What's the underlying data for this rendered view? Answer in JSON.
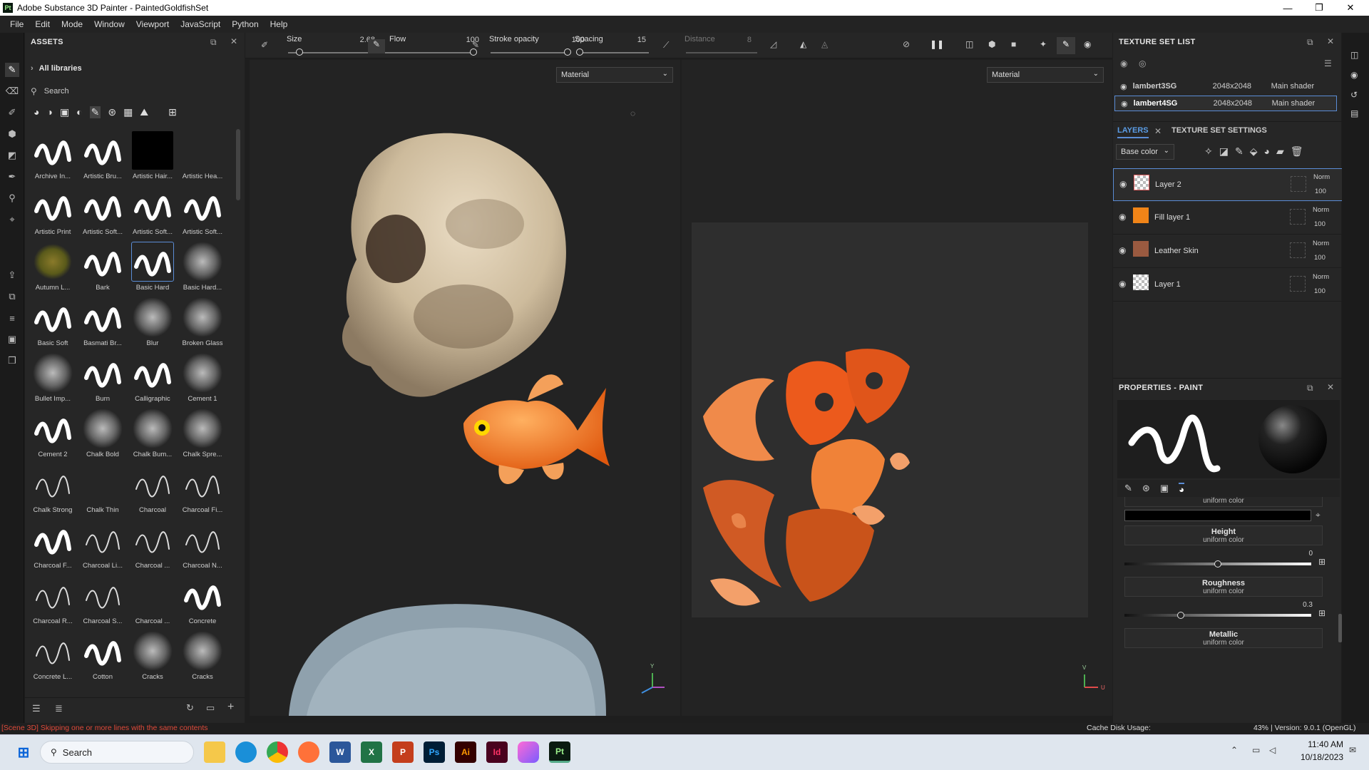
{
  "window": {
    "app_badge": "Pt",
    "title": "Adobe Substance 3D Painter - PaintedGoldfishSet",
    "minimize": "—",
    "maximize": "❐",
    "close": "✕"
  },
  "menu": [
    "File",
    "Edit",
    "Mode",
    "Window",
    "Viewport",
    "JavaScript",
    "Python",
    "Help"
  ],
  "assets": {
    "title": "ASSETS",
    "breadcrumb": "All libraries",
    "search_placeholder": "Search",
    "brushes": [
      {
        "label": "Archive In...",
        "style": "w"
      },
      {
        "label": "Artistic Bru...",
        "style": "w"
      },
      {
        "label": "Artistic Hair...",
        "style": "b"
      },
      {
        "label": "Artistic Hea...",
        "style": "d"
      },
      {
        "label": "Artistic Print",
        "style": "w"
      },
      {
        "label": "Artistic Soft...",
        "style": "w"
      },
      {
        "label": "Artistic Soft...",
        "style": "w"
      },
      {
        "label": "Artistic Soft...",
        "style": "w"
      },
      {
        "label": "Autumn L...",
        "style": "leaf"
      },
      {
        "label": "Bark",
        "style": "w"
      },
      {
        "label": "Basic Hard",
        "style": "w"
      },
      {
        "label": "Basic Hard...",
        "style": "g"
      },
      {
        "label": "Basic Soft",
        "style": "w"
      },
      {
        "label": "Basmati Br...",
        "style": "w"
      },
      {
        "label": "Blur",
        "style": "g"
      },
      {
        "label": "Broken Glass",
        "style": "g"
      },
      {
        "label": "Bullet Imp...",
        "style": "g"
      },
      {
        "label": "Burn",
        "style": "w"
      },
      {
        "label": "Calligraphic",
        "style": "w"
      },
      {
        "label": "Cement 1",
        "style": "g"
      },
      {
        "label": "Cement 2",
        "style": "w"
      },
      {
        "label": "Chalk Bold",
        "style": "g"
      },
      {
        "label": "Chalk Bum...",
        "style": "g"
      },
      {
        "label": "Chalk Spre...",
        "style": "g"
      },
      {
        "label": "Chalk Strong",
        "style": "t"
      },
      {
        "label": "Chalk Thin",
        "style": "d"
      },
      {
        "label": "Charcoal",
        "style": "t"
      },
      {
        "label": "Charcoal Fi...",
        "style": "t"
      },
      {
        "label": "Charcoal F...",
        "style": "w"
      },
      {
        "label": "Charcoal Li...",
        "style": "t"
      },
      {
        "label": "Charcoal ...",
        "style": "t"
      },
      {
        "label": "Charcoal N...",
        "style": "t"
      },
      {
        "label": "Charcoal R...",
        "style": "t"
      },
      {
        "label": "Charcoal S...",
        "style": "t"
      },
      {
        "label": "Charcoal ...",
        "style": "d"
      },
      {
        "label": "Concrete",
        "style": "w"
      },
      {
        "label": "Concrete L...",
        "style": "t"
      },
      {
        "label": "Cotton",
        "style": "w"
      },
      {
        "label": "Cracks",
        "style": "g"
      },
      {
        "label": "Cracks",
        "style": "g"
      }
    ],
    "selected_index": 10
  },
  "toolbar": {
    "size_label": "Size",
    "size_value": "2.68",
    "flow_label": "Flow",
    "flow_value": "100",
    "stroke_label": "Stroke opacity",
    "stroke_value": "100",
    "spacing_label": "Spacing",
    "spacing_value": "15",
    "distance_label": "Distance",
    "distance_value": "8",
    "size_fraction": 0.1,
    "flow_fraction": 1.0,
    "stroke_fraction": 1.0,
    "spacing_fraction": 0.05
  },
  "viewport": {
    "left_mode": "Material",
    "right_mode": "Material",
    "axis_y": "Y",
    "axis_v": "V",
    "axis_u": "U"
  },
  "texture_set_list": {
    "title": "TEXTURE SET LIST",
    "rows": [
      {
        "name": "lambert3SG",
        "res": "2048x2048",
        "shader": "Main shader"
      },
      {
        "name": "lambert4SG",
        "res": "2048x2048",
        "shader": "Main shader"
      }
    ]
  },
  "layers": {
    "tab": "LAYERS",
    "tab2": "TEXTURE SET SETTINGS",
    "channel": "Base color",
    "items": [
      {
        "name": "Layer 2",
        "blend": "Norm",
        "opacity": "100"
      },
      {
        "name": "Fill layer 1",
        "blend": "Norm",
        "opacity": "100"
      },
      {
        "name": "Leather Skin",
        "blend": "Norm",
        "opacity": "100"
      },
      {
        "name": "Layer 1",
        "blend": "Norm",
        "opacity": "100"
      }
    ]
  },
  "properties": {
    "title": "PROPERTIES - PAINT",
    "color_sub": "uniform color",
    "height": {
      "title": "Height",
      "sub": "uniform color",
      "value": "0",
      "fraction": 0.5
    },
    "roughness": {
      "title": "Roughness",
      "sub": "uniform color",
      "value": "0.3",
      "fraction": 0.3
    },
    "metallic": {
      "title": "Metallic",
      "sub": "uniform color"
    }
  },
  "status": {
    "message": "[Scene 3D] Skipping one or more lines with the same contents",
    "cache": "Cache Disk Usage:",
    "cache_pct": "43%",
    "version": "| Version: 9.0.1 (OpenGL)"
  },
  "taskbar": {
    "search": "Search",
    "time": "11:40 AM",
    "date": "10/18/2023",
    "apps": [
      {
        "name": "W",
        "color": "#2b579a"
      },
      {
        "name": "X",
        "color": "#217346"
      },
      {
        "name": "P",
        "color": "#c43e1c"
      },
      {
        "name": "Ps",
        "color": "#001e36"
      },
      {
        "name": "Ai",
        "color": "#330000"
      },
      {
        "name": "Id",
        "color": "#49021f"
      },
      {
        "name": "Pt",
        "color": "#0a1a10"
      }
    ]
  },
  "colors": {
    "accent": "#5b8dd6",
    "fish": "#f07a1e"
  }
}
